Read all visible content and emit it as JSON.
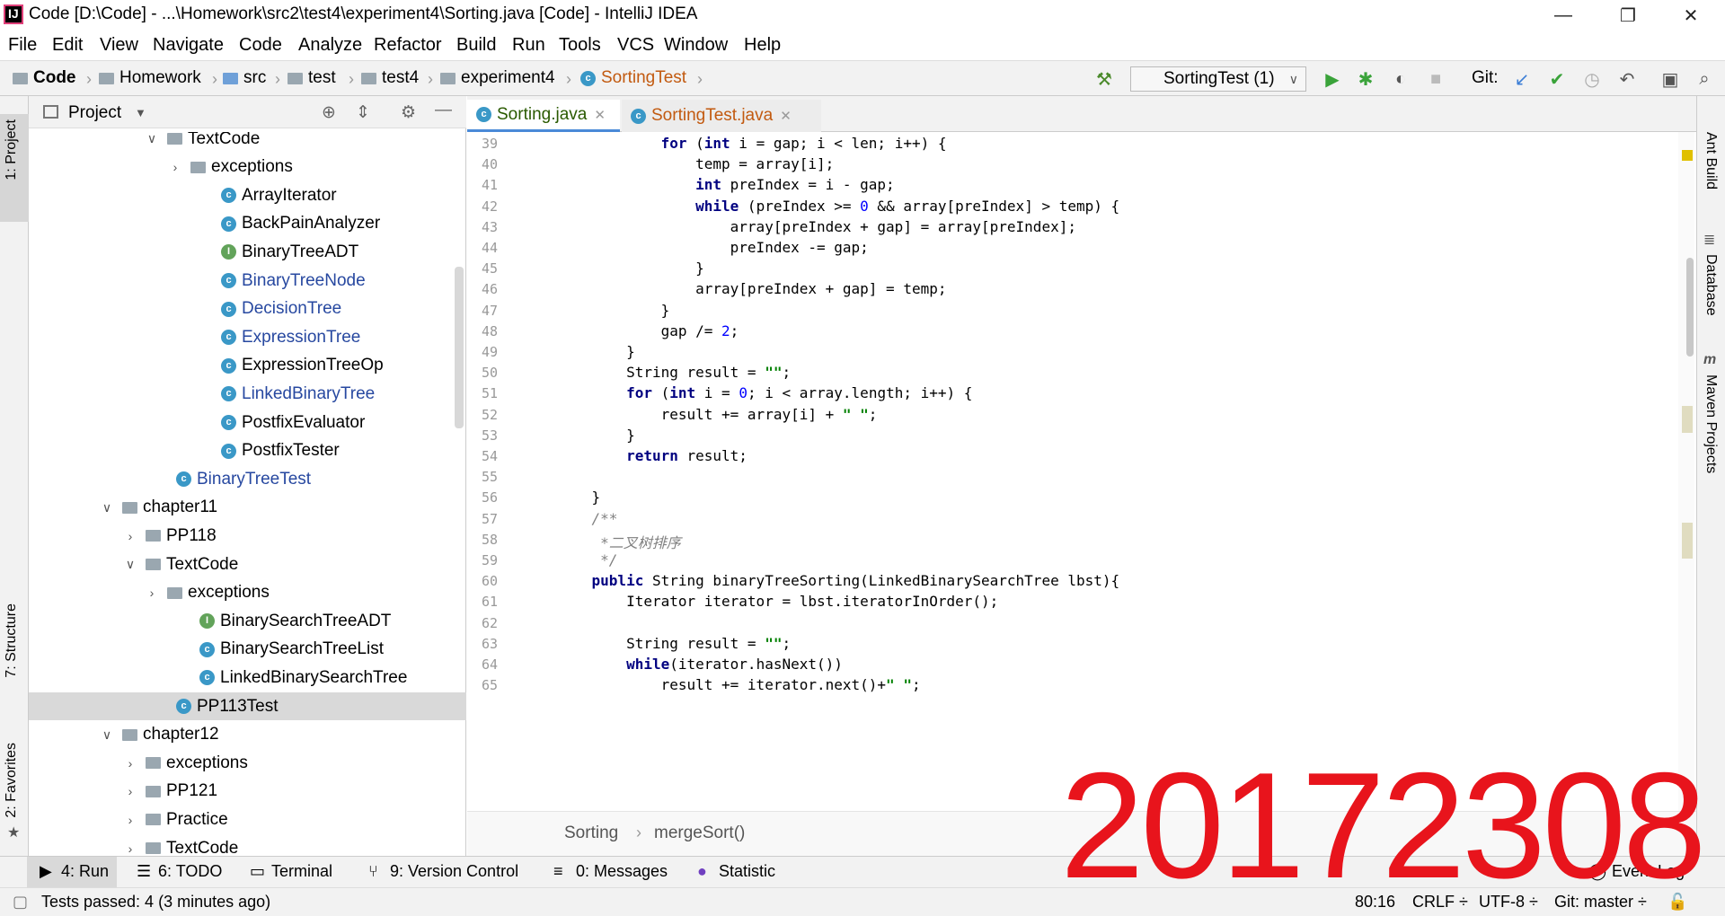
{
  "window": {
    "title": "Code [D:\\Code] - ...\\Homework\\src2\\test4\\experiment4\\Sorting.java [Code] - IntelliJ IDEA"
  },
  "menu": [
    "File",
    "Edit",
    "View",
    "Navigate",
    "Code",
    "Analyze",
    "Refactor",
    "Build",
    "Run",
    "Tools",
    "VCS",
    "Window",
    "Help"
  ],
  "breadcrumbs": [
    "Code",
    "Homework",
    "src",
    "test",
    "test4",
    "experiment4",
    "SortingTest"
  ],
  "toolbar": {
    "run_config": "SortingTest (1)",
    "git_label": "Git:"
  },
  "side_tabs": {
    "project": "1: Project",
    "structure": "7: Structure",
    "favorites": "2: Favorites",
    "ant": "Ant Build",
    "database": "Database",
    "maven": "Maven Projects"
  },
  "project_panel": {
    "title": "Project"
  },
  "tree": [
    {
      "label": "TextCode",
      "type": "folder",
      "expanded": true
    },
    {
      "label": "exceptions",
      "type": "folder",
      "expanded": false
    },
    {
      "label": "ArrayIterator",
      "type": "class"
    },
    {
      "label": "BackPainAnalyzer",
      "type": "class"
    },
    {
      "label": "BinaryTreeADT",
      "type": "interface"
    },
    {
      "label": "BinaryTreeNode",
      "type": "class"
    },
    {
      "label": "DecisionTree",
      "type": "class"
    },
    {
      "label": "ExpressionTree",
      "type": "class"
    },
    {
      "label": "ExpressionTreeOp",
      "type": "class"
    },
    {
      "label": "LinkedBinaryTree",
      "type": "class"
    },
    {
      "label": "PostfixEvaluator",
      "type": "class"
    },
    {
      "label": "PostfixTester",
      "type": "class"
    },
    {
      "label": "BinaryTreeTest",
      "type": "class"
    },
    {
      "label": "chapter11",
      "type": "folder",
      "expanded": true
    },
    {
      "label": "PP118",
      "type": "folder",
      "expanded": false
    },
    {
      "label": "TextCode",
      "type": "folder",
      "expanded": true
    },
    {
      "label": "exceptions",
      "type": "folder",
      "expanded": false
    },
    {
      "label": "BinarySearchTreeADT",
      "type": "interface"
    },
    {
      "label": "BinarySearchTreeList",
      "type": "class"
    },
    {
      "label": "LinkedBinarySearchTree",
      "type": "class"
    },
    {
      "label": "PP113Test",
      "type": "class",
      "selected": true
    },
    {
      "label": "chapter12",
      "type": "folder",
      "expanded": true
    },
    {
      "label": "exceptions",
      "type": "folder",
      "expanded": false
    },
    {
      "label": "PP121",
      "type": "folder",
      "expanded": false
    },
    {
      "label": "Practice",
      "type": "folder",
      "expanded": false
    },
    {
      "label": "TextCode",
      "type": "folder",
      "expanded": false
    }
  ],
  "editor_tabs": [
    "Sorting.java",
    "SortingTest.java"
  ],
  "line_numbers": [
    "39",
    "40",
    "41",
    "42",
    "43",
    "44",
    "45",
    "46",
    "47",
    "48",
    "49",
    "50",
    "51",
    "52",
    "53",
    "54",
    "55",
    "56",
    "57",
    "58",
    "59",
    "60",
    "61",
    "62",
    "63",
    "64",
    "65"
  ],
  "code_lines": [
    "            for (int i = gap; i < len; i++) {",
    "                temp = array[i];",
    "                int preIndex = i - gap;",
    "                while (preIndex >= 0 && array[preIndex] > temp) {",
    "                    array[preIndex + gap] = array[preIndex];",
    "                    preIndex -= gap;",
    "                }",
    "                array[preIndex + gap] = temp;",
    "            }",
    "            gap /= 2;",
    "        }",
    "        String result = \"\";",
    "        for (int i = 0; i < array.length; i++) {",
    "            result += array[i] + \" \";",
    "        }",
    "        return result;",
    "",
    "    }",
    "    /**",
    "     *二叉树排序",
    "     */",
    "    public String binaryTreeSorting(LinkedBinarySearchTree lbst){",
    "        Iterator iterator = lbst.iteratorInOrder();",
    "",
    "        String result = \"\";",
    "        while(iterator.hasNext())",
    "            result += iterator.next()+\" \";"
  ],
  "editor_breadcrumb": [
    "Sorting",
    "mergeSort()"
  ],
  "bottom_tabs": [
    "4: Run",
    "6: TODO",
    "Terminal",
    "9: Version Control",
    "0: Messages",
    "Statistic",
    "Event Log"
  ],
  "status": {
    "message": "Tests passed: 4 (3 minutes ago)",
    "position": "80:16",
    "line_sep": "CRLF ÷",
    "encoding": "UTF-8 ÷",
    "git": "Git: master ÷"
  },
  "watermark": "20172308",
  "colors": {
    "watermark": "#e8141c",
    "keyword": "#000080",
    "string": "#008000",
    "number": "#0000ff",
    "comment": "#808080"
  }
}
